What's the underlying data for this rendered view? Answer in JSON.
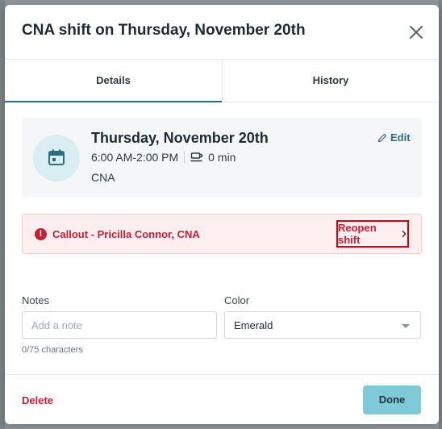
{
  "modal": {
    "title": "CNA shift on Thursday, November 20th"
  },
  "tabs": [
    {
      "label": "Details",
      "active": true
    },
    {
      "label": "History",
      "active": false
    }
  ],
  "shift": {
    "date": "Thursday, November 20th",
    "time": "6:00 AM-2:00 PM",
    "break": "0 min",
    "role": "CNA",
    "edit_label": "Edit"
  },
  "callout": {
    "text": "Callout - Pricilla Connor, CNA",
    "action_label": "Reopen shift",
    "icon": "alert-icon"
  },
  "form": {
    "notes": {
      "label": "Notes",
      "placeholder": "Add a note",
      "value": "",
      "char_count": "0/75 characters"
    },
    "color": {
      "label": "Color",
      "value": "Emerald"
    }
  },
  "footer": {
    "delete_label": "Delete",
    "done_label": "Done"
  },
  "colors": {
    "accent": "#2b6c83",
    "danger": "#c81e33",
    "done_button": "#7fcad6",
    "callout_bg": "#fdeef0"
  }
}
